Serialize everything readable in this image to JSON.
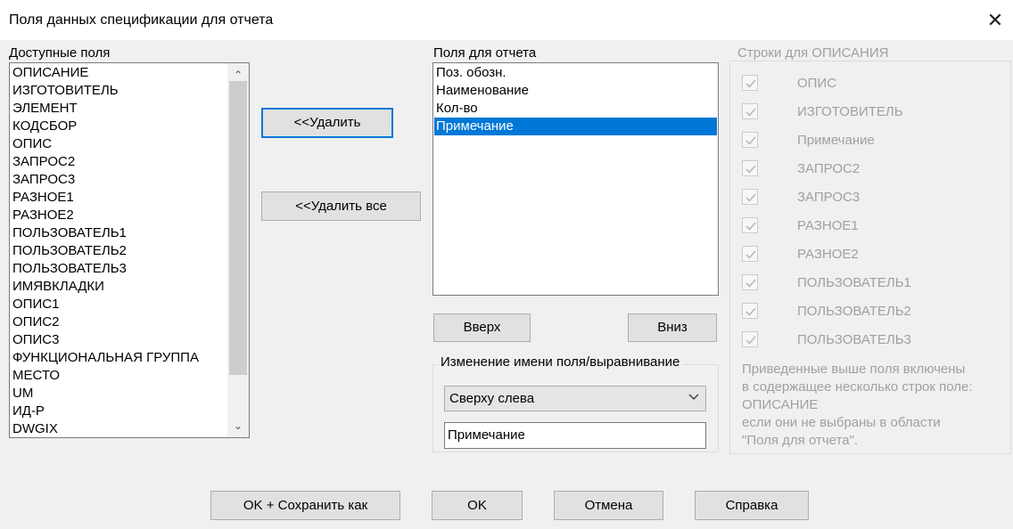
{
  "window": {
    "title": "Поля данных спецификации для отчета"
  },
  "available": {
    "label": "Доступные поля",
    "items": [
      "ОПИСАНИЕ",
      "ИЗГОТОВИТЕЛЬ",
      "ЭЛЕМЕНТ",
      "КОДСБОР",
      "ОПИС",
      "ЗАПРОС2",
      "ЗАПРОС3",
      "РАЗНОЕ1",
      "РАЗНОЕ2",
      "ПОЛЬЗОВАТЕЛЬ1",
      "ПОЛЬЗОВАТЕЛЬ2",
      "ПОЛЬЗОВАТЕЛЬ3",
      "ИМЯВКЛАДКИ",
      "ОПИС1",
      "ОПИС2",
      "ОПИС3",
      "ФУНКЦИОНАЛЬНАЯ ГРУППА",
      "МЕСТО",
      "UM",
      "ИД-Р",
      "DWGIX"
    ]
  },
  "buttons": {
    "remove": "<<Удалить",
    "remove_all": "<<Удалить все",
    "up": "Вверх",
    "down": "Вниз",
    "ok_save_as": "OK + Сохранить как",
    "ok": "OK",
    "cancel": "Отмена",
    "help": "Справка"
  },
  "report": {
    "label": "Поля для отчета",
    "items": [
      "Поз. обозн.",
      "Наименование",
      "Кол-во",
      "Примечание"
    ],
    "selected_index": 3
  },
  "rename": {
    "label": "Изменение имени поля/выравнивание",
    "alignment": "Сверху слева",
    "field_name": "Примечание"
  },
  "description": {
    "label": "Строки для ОПИСАНИЯ",
    "rows": [
      {
        "label": "ОПИС",
        "checked": true
      },
      {
        "label": "ИЗГОТОВИТЕЛЬ",
        "checked": true
      },
      {
        "label": "Примечание",
        "checked": true
      },
      {
        "label": "ЗАПРОС2",
        "checked": true
      },
      {
        "label": "ЗАПРОС3",
        "checked": true
      },
      {
        "label": "РАЗНОЕ1",
        "checked": true
      },
      {
        "label": "РАЗНОЕ2",
        "checked": true
      },
      {
        "label": "ПОЛЬЗОВАТЕЛЬ1",
        "checked": true
      },
      {
        "label": "ПОЛЬЗОВАТЕЛЬ2",
        "checked": true
      },
      {
        "label": "ПОЛЬЗОВАТЕЛЬ3",
        "checked": true
      }
    ],
    "note_lines": [
      "Приведенные выше поля включены",
      "в содержащее несколько строк поле:",
      "ОПИСАНИЕ",
      "если они не выбраны в области",
      "\"Поля для отчета\"."
    ]
  }
}
